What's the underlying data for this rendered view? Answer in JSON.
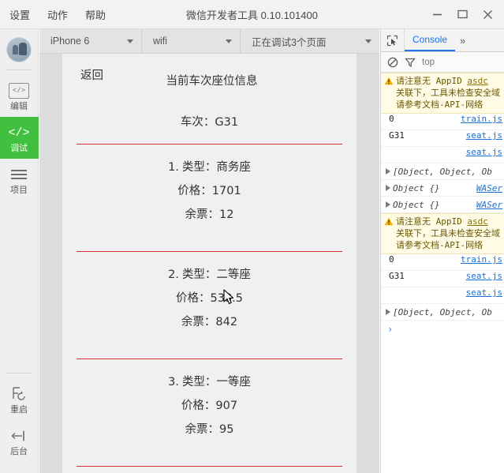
{
  "titlebar": {
    "menus": [
      {
        "label": "设置",
        "name": "menu-settings"
      },
      {
        "label": "动作",
        "name": "menu-actions"
      },
      {
        "label": "帮助",
        "name": "menu-help"
      }
    ],
    "app_title": "微信开发者工具 0.10.101400",
    "controls": {
      "minimize": "minimize-button",
      "maximize": "maximize-button",
      "close": "close-button"
    }
  },
  "sidebar": {
    "items": [
      {
        "label": "编辑",
        "icon": "code-box-icon",
        "active": false
      },
      {
        "label": "调试",
        "icon": "code-slash-icon",
        "active": true
      },
      {
        "label": "项目",
        "icon": "hamburger-icon",
        "active": false
      }
    ],
    "bottom_items": [
      {
        "label": "重启",
        "icon": "restart-icon"
      },
      {
        "label": "后台",
        "icon": "background-icon"
      }
    ],
    "active_color": "#41bf3f"
  },
  "simulator": {
    "device": "iPhone 6",
    "network": "wifi",
    "pages_status": "正在调试3个页面",
    "screen": {
      "back_label": "返回",
      "title": "当前车次座位信息",
      "train_label": "车次：G31",
      "seats": [
        {
          "index": "1.",
          "type_line": "类型：商务座",
          "price_line": "价格：1701",
          "remaining_line": "余票：12"
        },
        {
          "index": "2.",
          "type_line": "类型：二等座",
          "price_line": "价格：538.5",
          "remaining_line": "余票：842"
        },
        {
          "index": "3.",
          "type_line": "类型：一等座",
          "price_line": "价格：907",
          "remaining_line": "余票：95"
        }
      ],
      "divider_color": "#d0342c"
    }
  },
  "devtools": {
    "tabs": [
      {
        "label": "Console",
        "active": true
      }
    ],
    "more_label": "»",
    "context": "top",
    "console": {
      "warning": {
        "line1_a": "请注意无",
        "line1_mono": "AppID",
        "line1_link": "asdc",
        "line2": "关联下，工具未检查安全域",
        "line3_a": "请参考文档",
        "line3_mono": "-API-",
        "line3_b": "网络"
      },
      "entries": [
        {
          "value": "0",
          "source": "train.js"
        },
        {
          "value": "G31",
          "source": "seat.js"
        },
        {
          "value": "",
          "source": "seat.js"
        },
        {
          "object": "[Object, Object, Ob"
        },
        {
          "object": "Object {}",
          "source": "WASer"
        },
        {
          "object": "Object {}",
          "source": "WASer"
        }
      ],
      "entries2": [
        {
          "value": "0",
          "source": "train.js"
        },
        {
          "value": "G31",
          "source": "seat.js"
        },
        {
          "value": "",
          "source": "seat.js"
        },
        {
          "object": "[Object, Object, Ob"
        }
      ],
      "prompt": "›"
    }
  }
}
